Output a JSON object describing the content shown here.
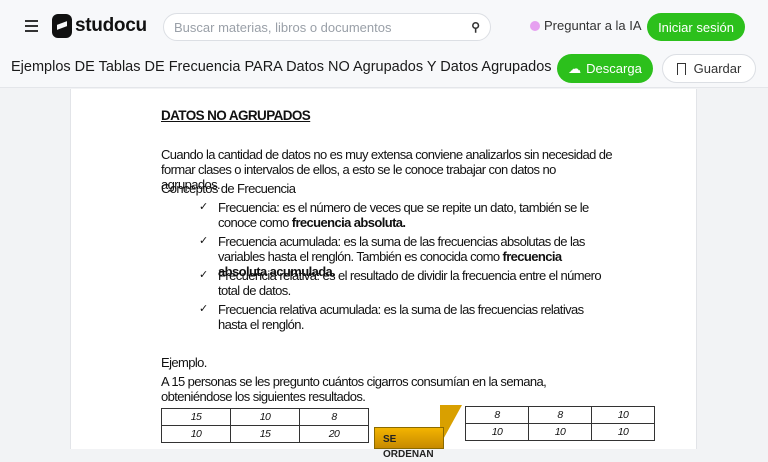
{
  "header": {
    "logo": "studocu",
    "search_placeholder": "Buscar materias, libros o documentos",
    "ask_ai": "Preguntar a la IA",
    "login": "Iniciar sesión"
  },
  "document": {
    "title": "Ejemplos DE Tablas DE Frecuencia PARA Datos NO Agrupados Y Datos Agrupados",
    "download": "Descarga",
    "save": "Guardar"
  },
  "content": {
    "heading": "DATOS NO AGRUPADOS",
    "intro": "Cuando la cantidad de datos no es muy extensa conviene analizarlos sin necesidad de formar clases o intervalos de ellos, a esto se le conoce trabajar con datos no agrupados.",
    "concepts": "Conceptos  de Frecuencia",
    "items": [
      {
        "text": "Frecuencia: es el número de veces que se repite un dato, también se le conoce como ",
        "bold": "frecuencia absoluta."
      },
      {
        "text": "Frecuencia acumulada: es la suma de las frecuencias absolutas de las variables hasta el renglón. También es conocida como ",
        "bold": "frecuencia absoluta acumulada."
      },
      {
        "text": "Frecuencia relativa: es el resultado de dividir la frecuencia entre el número total de datos.",
        "bold": ""
      },
      {
        "text": "Frecuencia relativa acumulada: es la suma de las frecuencias relativas hasta el renglón.",
        "bold": ""
      }
    ],
    "example": "Ejemplo.",
    "example_text": "A 15  personas se les pregunto cuántos cigarros consumían en la semana, obteniéndose los siguientes resultados.",
    "arrow_label": "SE ORDENAN",
    "table_raw": [
      [
        "15",
        "10",
        "8"
      ],
      [
        "10",
        "15",
        "20"
      ]
    ],
    "table_sorted": [
      [
        "8",
        "8",
        "10"
      ],
      [
        "10",
        "10",
        "10"
      ]
    ]
  }
}
